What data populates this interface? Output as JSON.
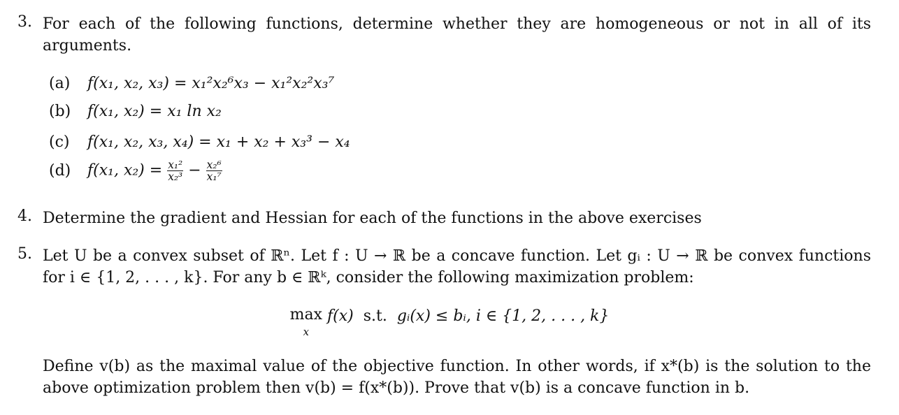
{
  "q3": {
    "number": "3.",
    "text": "For each of the following functions, determine whether they are homogeneous or not in all of its arguments.",
    "items": [
      {
        "label": "(a)",
        "lhs": "f(x₁, x₂, x₃) =",
        "rhs": "x₁²x₂⁶x₃ − x₁²x₂²x₃⁷"
      },
      {
        "label": "(b)",
        "lhs": "f(x₁, x₂) =",
        "rhs": "x₁ ln x₂"
      },
      {
        "label": "(c)",
        "lhs": "f(x₁, x₂, x₃, x₄) =",
        "rhs": "x₁ + x₂ + x₃³ − x₄"
      },
      {
        "label": "(d)",
        "lhs": "f(x₁, x₂) =",
        "frac1_num": "x₁²",
        "frac1_den": "x₂³",
        "minus": "−",
        "frac2_num": "x₂⁶",
        "frac2_den": "x₁⁷"
      }
    ]
  },
  "q4": {
    "number": "4.",
    "text": "Determine the gradient and Hessian for each of the functions in the above exercises"
  },
  "q5": {
    "number": "5.",
    "text": "Let U be a convex subset of ℝⁿ. Let f : U → ℝ be a concave function. Let gᵢ : U → ℝ be convex functions for i ∈ {1, 2, . . . , k}. For any b ∈ ℝᵏ, consider the following maximization problem:",
    "display": {
      "op": "max",
      "under": "x",
      "objective": "f(x)",
      "st": "s.t.",
      "constraint": "gᵢ(x) ≤ bᵢ, i ∈ {1, 2, . . . , k}"
    },
    "text2": "Define v(b) as the maximal value of the objective function. In other words, if x*(b) is the solution to the above optimization problem then v(b) = f(x*(b)). Prove that v(b) is a concave function in b."
  }
}
